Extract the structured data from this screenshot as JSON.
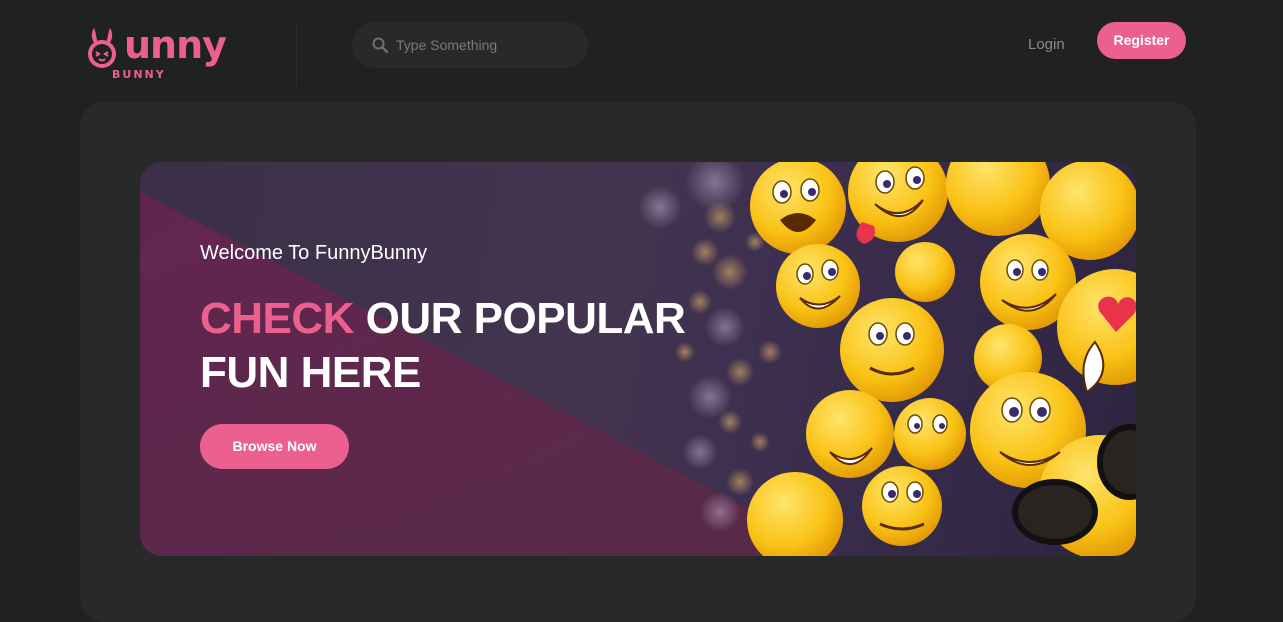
{
  "header": {
    "logo": {
      "word": "unny",
      "sub": "BUNNY"
    },
    "search": {
      "placeholder": "Type Something",
      "icon": "search-icon"
    },
    "login_label": "Login",
    "register_label": "Register"
  },
  "banner": {
    "welcome": "Welcome To FunnyBunny",
    "headline_accent": "CHECK",
    "headline_rest_line1": " OUR POPULAR",
    "headline_line2": "FUN HERE",
    "browse_label": "Browse Now"
  },
  "colors": {
    "accent": "#ec6090",
    "page_bg": "#1f2122",
    "panel_bg": "#27292a"
  }
}
